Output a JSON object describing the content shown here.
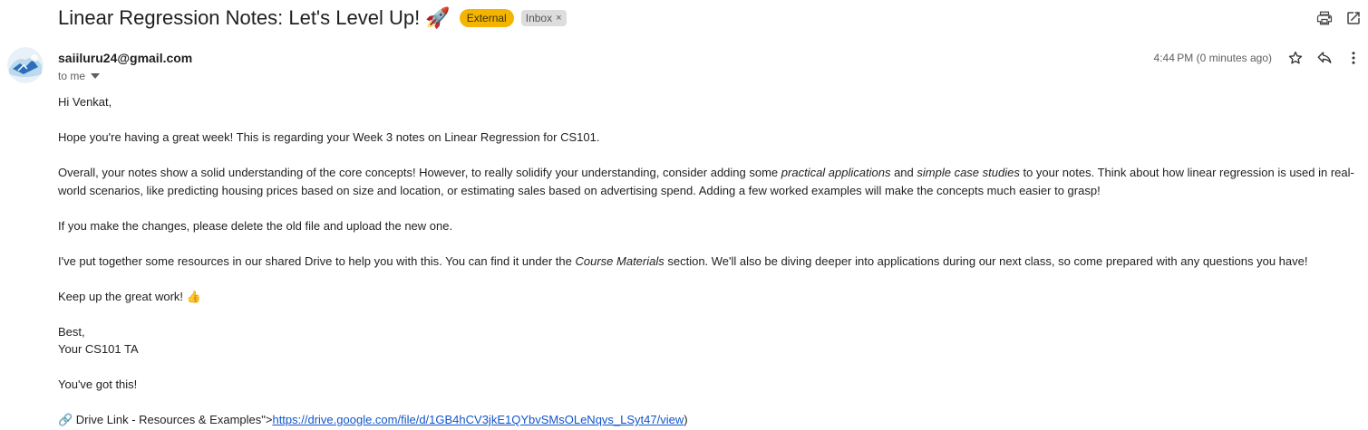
{
  "header": {
    "subject": "Linear Regression Notes: Let's Level Up! 🚀",
    "external_label": "External",
    "inbox_label": "Inbox",
    "inbox_remove": "×"
  },
  "message": {
    "sender": "saiiluru24@gmail.com",
    "to_label": "to me",
    "timestamp": "4:44 PM (0 minutes ago)",
    "body": {
      "greeting": "Hi Venkat,",
      "p1": "Hope you're having a great week! This is regarding your Week 3 notes on Linear Regression for CS101.",
      "p2_a": "Overall, your notes show a solid understanding of the core concepts! However, to really solidify your understanding, consider adding some ",
      "p2_em1": "practical applications",
      "p2_b": " and ",
      "p2_em2": "simple case studies",
      "p2_c": " to your notes. Think about how linear regression is used in real-world scenarios, like predicting housing prices based on size and location, or estimating sales based on advertising spend. Adding a few worked examples will make the concepts much easier to grasp!",
      "p3": "If you make the changes, please delete the old file and upload the new one.",
      "p4_a": "I've put together some resources in our shared Drive to help you with this. You can find it under the ",
      "p4_em": "Course Materials",
      "p4_b": " section. We'll also be diving deeper into applications during our next class, so come prepared with any questions you have!",
      "p5": "Keep up the great work! 👍",
      "signoff": "Best,",
      "signature": "Your CS101 TA",
      "p6": "You've got this!",
      "link_prefix": "🔗 Drive Link - Resources & Examples\">",
      "link_text": "https://drive.google.com/file/d/1GB4hCV3jkE1QYbvSMsOLeNqvs_LSyt47/view",
      "link_suffix": ")"
    }
  },
  "colors": {
    "external_badge": "#f5b400",
    "link": "#1155cc"
  },
  "icons": [
    "print-icon",
    "open-in-new-window-icon",
    "star-icon",
    "reply-icon",
    "more-vert-icon",
    "chevron-down-icon"
  ]
}
